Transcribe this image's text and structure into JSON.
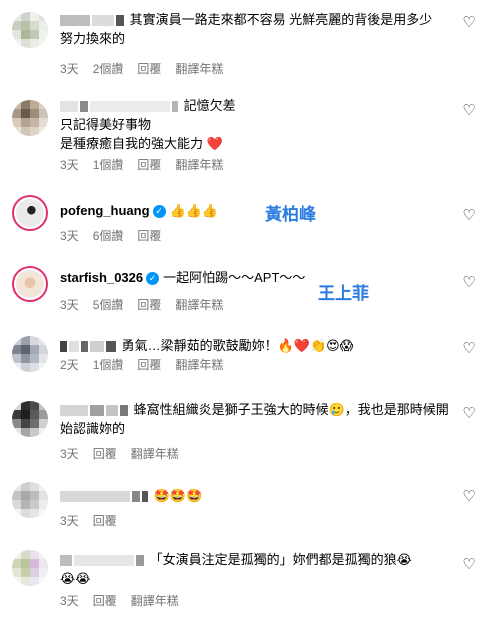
{
  "comments": [
    {
      "text_lines": [
        "其實演員一路走來都不容易 光鮮亮麗的背後是用多少",
        "努力換來的"
      ],
      "meta": [
        "3天",
        "2個讚",
        "回覆",
        "翻譯年糕"
      ]
    },
    {
      "text_lines": [
        "記憶欠差",
        "只記得美好事物",
        "是種療癒自我的強大能力 ❤️"
      ],
      "meta": [
        "3天",
        "1個讚",
        "回覆",
        "翻譯年糕"
      ]
    },
    {
      "username": "pofeng_huang",
      "text": "👍👍👍",
      "overlay": "黃柏峰",
      "meta": [
        "3天",
        "6個讚",
        "回覆"
      ]
    },
    {
      "username": "starfish_0326",
      "text": "一起阿怕踢～～APT～～",
      "overlay": "王上菲",
      "meta": [
        "3天",
        "5個讚",
        "回覆",
        "翻譯年糕"
      ]
    },
    {
      "text_lines": [
        "勇氣…梁靜茹的歌鼓勵妳！🔥❤️👏😍😱"
      ],
      "meta": [
        "2天",
        "1個讚",
        "回覆",
        "翻譯年糕"
      ]
    },
    {
      "text_lines": [
        "蜂窩性組織炎是獅子王強大的時候🥲，我也是那時候開",
        "始認識妳的"
      ],
      "meta": [
        "3天",
        "回覆",
        "翻譯年糕"
      ]
    },
    {
      "text_lines": [
        "🤩🤩🤩"
      ],
      "meta": [
        "3天",
        "回覆"
      ]
    },
    {
      "text_lines": [
        "「女演員注定是孤獨的」妳們都是孤獨的狼😭",
        "😭😭"
      ],
      "meta": [
        "3天",
        "回覆",
        "翻譯年糕"
      ]
    }
  ],
  "icons": {
    "like": "heart-outline-icon",
    "verified": "verified-badge-icon"
  },
  "colors": {
    "meta_text": "#737373",
    "verified": "#0095f6",
    "overlay": "#2b7ce0"
  }
}
